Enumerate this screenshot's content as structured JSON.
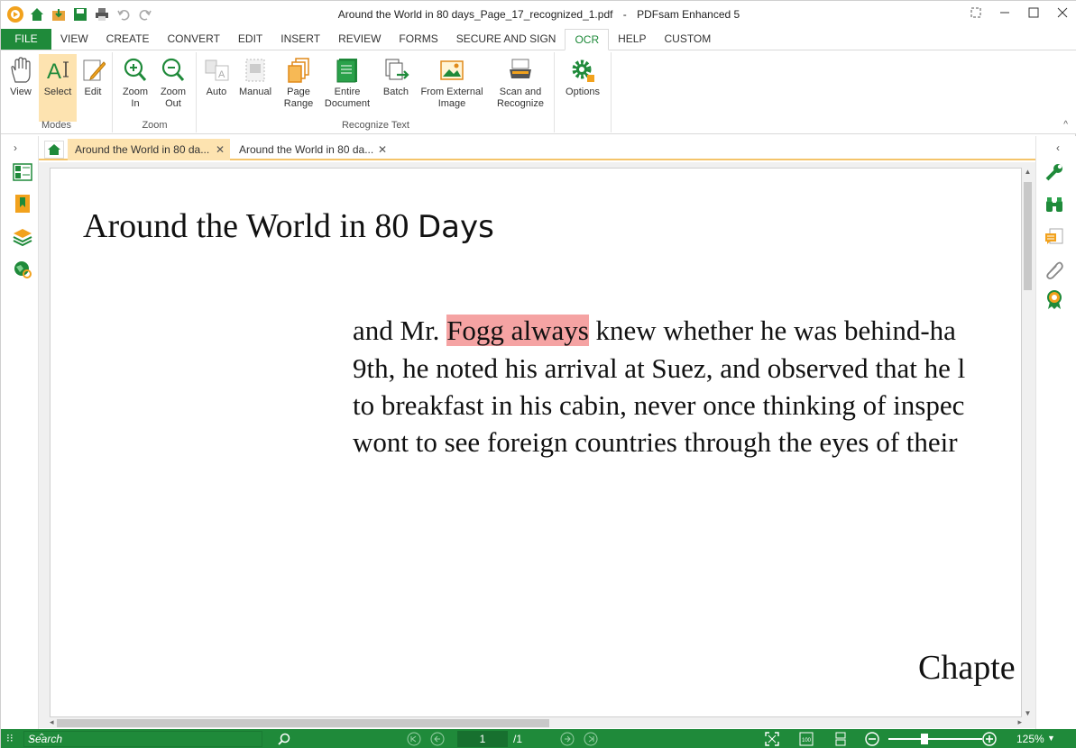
{
  "window": {
    "document_name": "Around the World in 80 days_Page_17_recognized_1.pdf",
    "separator": "-",
    "app_name": "PDFsam Enhanced 5"
  },
  "menu": {
    "tabs": [
      "FILE",
      "VIEW",
      "CREATE",
      "CONVERT",
      "EDIT",
      "INSERT",
      "REVIEW",
      "FORMS",
      "SECURE AND SIGN",
      "OCR",
      "HELP",
      "CUSTOM"
    ],
    "active": "OCR"
  },
  "ribbon": {
    "groups": {
      "modes": "Modes",
      "zoom": "Zoom",
      "recognize": "Recognize Text"
    },
    "buttons": {
      "view": "View",
      "select": "Select",
      "edit": "Edit",
      "zoom_in_1": "Zoom",
      "zoom_in_2": "In",
      "zoom_out_1": "Zoom",
      "zoom_out_2": "Out",
      "auto": "Auto",
      "manual": "Manual",
      "page_range_1": "Page",
      "page_range_2": "Range",
      "entire_doc_1": "Entire",
      "entire_doc_2": "Document",
      "batch": "Batch",
      "external_1": "From External",
      "external_2": "Image",
      "scan_1": "Scan and",
      "scan_2": "Recognize",
      "options": "Options"
    }
  },
  "doc_tabs": [
    {
      "label": "Around the World in 80 da...",
      "active": true
    },
    {
      "label": "Around the World in 80 da...",
      "active": false
    }
  ],
  "page": {
    "heading_serif": "Around the World in 80 ",
    "heading_sans": "Days",
    "line1_pre": "and Mr. ",
    "line1_highlight": "Fogg always",
    "line1_post": " knew whether he was behind-ha",
    "line2": "9th, he noted his arrival at Suez, and observed that he l",
    "line3": "to breakfast in his cabin, never once thinking of inspec",
    "line4": "wont to see foreign countries through the eyes of their",
    "chapter": "Chapte"
  },
  "status": {
    "search_placeholder": "Search",
    "current_page": "1",
    "total_pages": "/1",
    "zoom": "125%"
  },
  "colors": {
    "brand_green": "#1f8a3a",
    "highlight": "#f5a3a3",
    "active_tab": "#fde3b0"
  }
}
